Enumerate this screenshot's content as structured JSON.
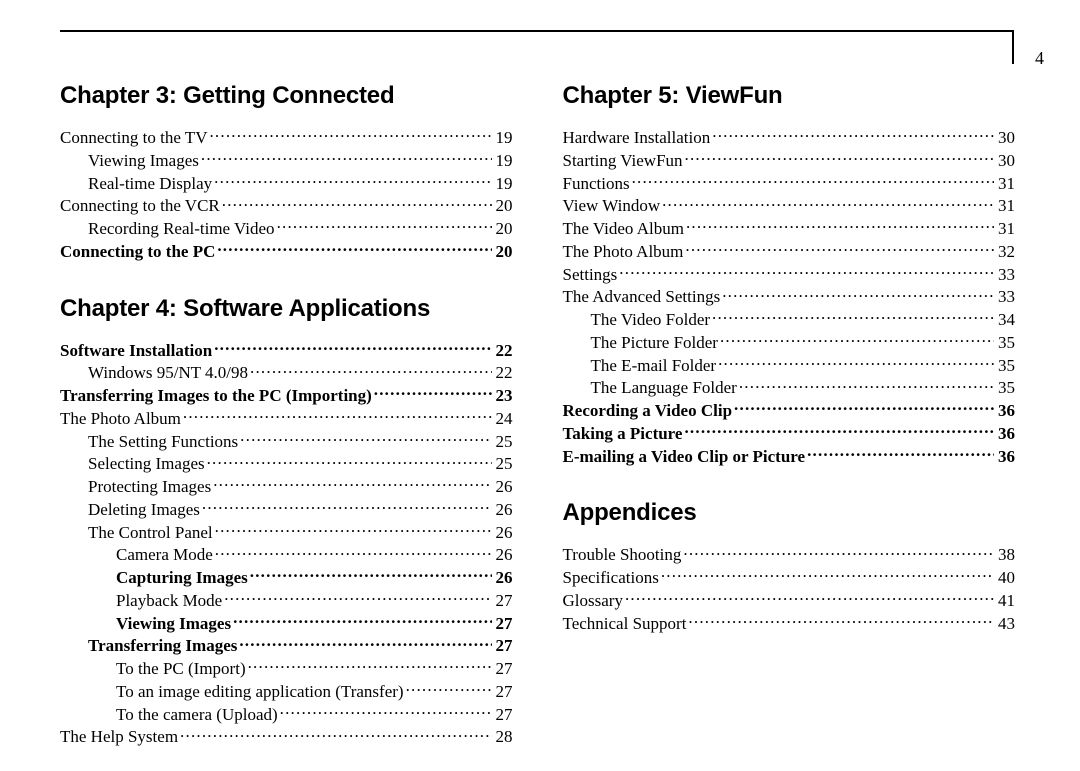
{
  "page_number": "4",
  "columns": [
    {
      "chapters": [
        {
          "title": "Chapter 3: Getting Connected",
          "entries": [
            {
              "label": "Connecting to the TV",
              "page": "19",
              "indent": 0,
              "bold": false
            },
            {
              "label": "Viewing Images",
              "page": "19",
              "indent": 1,
              "bold": false
            },
            {
              "label": "Real-time Display",
              "page": "19",
              "indent": 1,
              "bold": false
            },
            {
              "label": "Connecting to the VCR",
              "page": "20",
              "indent": 0,
              "bold": false
            },
            {
              "label": "Recording Real-time Video",
              "page": "20",
              "indent": 1,
              "bold": false
            },
            {
              "label": "Connecting to the PC",
              "page": "20",
              "indent": 0,
              "bold": true
            }
          ]
        },
        {
          "title": "Chapter 4: Software Applications",
          "entries": [
            {
              "label": "Software Installation",
              "page": "22",
              "indent": 0,
              "bold": true
            },
            {
              "label": "Windows 95/NT 4.0/98",
              "page": "22",
              "indent": 1,
              "bold": false
            },
            {
              "label": "Transferring Images to the PC (Importing)",
              "page": "23",
              "indent": 0,
              "bold": true
            },
            {
              "label": "The Photo Album",
              "page": "24",
              "indent": 0,
              "bold": false
            },
            {
              "label": "The Setting Functions",
              "page": "25",
              "indent": 1,
              "bold": false
            },
            {
              "label": "Selecting Images",
              "page": "25",
              "indent": 1,
              "bold": false
            },
            {
              "label": "Protecting Images",
              "page": "26",
              "indent": 1,
              "bold": false
            },
            {
              "label": "Deleting Images",
              "page": "26",
              "indent": 1,
              "bold": false
            },
            {
              "label": "The Control Panel",
              "page": "26",
              "indent": 1,
              "bold": false
            },
            {
              "label": "Camera Mode",
              "page": "26",
              "indent": 2,
              "bold": false
            },
            {
              "label": "Capturing Images",
              "page": "26",
              "indent": 2,
              "bold": true
            },
            {
              "label": "Playback Mode",
              "page": "27",
              "indent": 2,
              "bold": false
            },
            {
              "label": "Viewing Images",
              "page": "27",
              "indent": 2,
              "bold": true
            },
            {
              "label": "Transferring Images",
              "page": "27",
              "indent": 1,
              "bold": true
            },
            {
              "label": "To the PC  (Import)",
              "page": "27",
              "indent": 2,
              "bold": false
            },
            {
              "label": "To an image editing application  (Transfer)",
              "page": "27",
              "indent": 2,
              "bold": false
            },
            {
              "label": "To the camera (Upload)",
              "page": "27",
              "indent": 2,
              "bold": false
            },
            {
              "label": "The Help System",
              "page": "28",
              "indent": 0,
              "bold": false
            }
          ]
        }
      ]
    },
    {
      "chapters": [
        {
          "title": "Chapter 5: ViewFun",
          "entries": [
            {
              "label": "Hardware Installation",
              "page": "30",
              "indent": 0,
              "bold": false
            },
            {
              "label": "Starting ViewFun",
              "page": "30",
              "indent": 0,
              "bold": false
            },
            {
              "label": "Functions",
              "page": "31",
              "indent": 0,
              "bold": false
            },
            {
              "label": "View Window",
              "page": "31",
              "indent": 0,
              "bold": false
            },
            {
              "label": "The Video Album",
              "page": "31",
              "indent": 0,
              "bold": false
            },
            {
              "label": "The Photo Album",
              "page": "32",
              "indent": 0,
              "bold": false
            },
            {
              "label": "Settings",
              "page": "33",
              "indent": 0,
              "bold": false
            },
            {
              "label": "The Advanced Settings",
              "page": "33",
              "indent": 0,
              "bold": false
            },
            {
              "label": "The Video Folder",
              "page": "34",
              "indent": 1,
              "bold": false
            },
            {
              "label": "The Picture Folder",
              "page": "35",
              "indent": 1,
              "bold": false
            },
            {
              "label": "The E-mail Folder",
              "page": "35",
              "indent": 1,
              "bold": false
            },
            {
              "label": "The Language Folder",
              "page": "35",
              "indent": 1,
              "bold": false
            },
            {
              "label": "Recording a Video Clip",
              "page": "36",
              "indent": 0,
              "bold": true
            },
            {
              "label": "Taking a Picture",
              "page": "36",
              "indent": 0,
              "bold": true
            },
            {
              "label": "E-mailing a Video Clip or Picture",
              "page": "36",
              "indent": 0,
              "bold": true
            }
          ]
        },
        {
          "title": "Appendices",
          "entries": [
            {
              "label": "Trouble Shooting",
              "page": "38",
              "indent": 0,
              "bold": false
            },
            {
              "label": "Specifications",
              "page": "40",
              "indent": 0,
              "bold": false
            },
            {
              "label": "Glossary",
              "page": "41",
              "indent": 0,
              "bold": false
            },
            {
              "label": "Technical Support",
              "page": "43",
              "indent": 0,
              "bold": false
            }
          ]
        }
      ]
    }
  ]
}
